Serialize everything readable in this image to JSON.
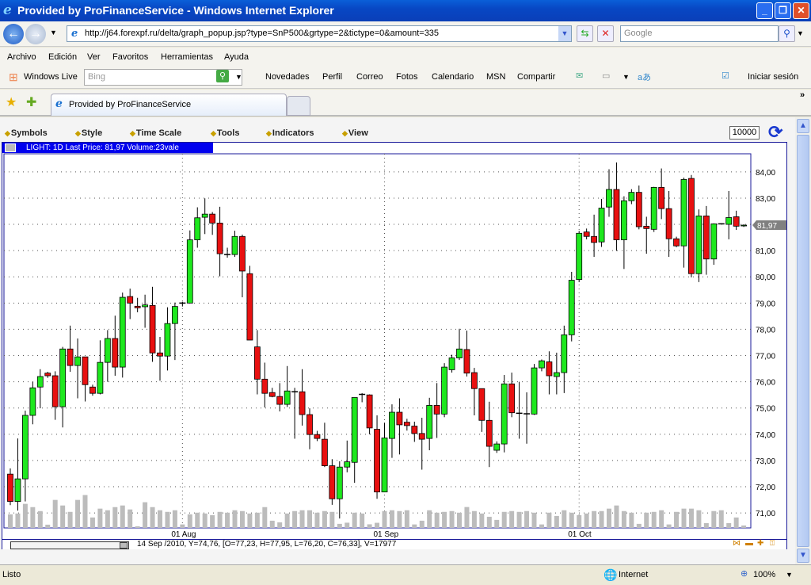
{
  "window": {
    "title": "Provided by ProFinanceService - Windows Internet Explorer"
  },
  "address": {
    "url": "http://j64.forexpf.ru/delta/graph_popup.jsp?type=SnP500&grtype=2&tictype=0&amount=335",
    "search_placeholder": "Google"
  },
  "menu": [
    "Archivo",
    "Edición",
    "Ver",
    "Favoritos",
    "Herramientas",
    "Ayuda"
  ],
  "links": {
    "brand": "Windows Live",
    "search_placeholder": "Bing",
    "items": [
      "Novedades",
      "Perfil",
      "Correo",
      "Fotos",
      "Calendario",
      "MSN",
      "Compartir"
    ],
    "signin": "Iniciar sesión"
  },
  "tab": {
    "title": "Provided by ProFinanceService"
  },
  "chart_toolbar": {
    "items": [
      "Symbols",
      "Style",
      "Time Scale",
      "Tools",
      "Indicators",
      "View"
    ],
    "amount": "10000"
  },
  "info": "LIGHT: 1D Last Price: 81,97 Volume:23vale",
  "crosshair_readout": "14 Sep /2010, Y=74,76, [O=77,23, H=77,95, L=76,20, C=76,33], V=17977",
  "status": {
    "left": "Listo",
    "zone": "Internet",
    "zoom": "100%"
  },
  "colors": {
    "up": "#1ee81e",
    "down": "#e81010",
    "volume": "#bcbcbc",
    "frame": "#1a1a9a",
    "infobar": "#0000ee"
  },
  "chart_data": {
    "type": "candlestick",
    "symbol": "LIGHT",
    "interval": "1D",
    "ylim": [
      70.43,
      84.69
    ],
    "yticks": [
      "84,00",
      "83,00",
      "82,00",
      "81,00",
      "80,00",
      "79,00",
      "78,00",
      "77,00",
      "76,00",
      "75,00",
      "74,00",
      "73,00",
      "72,00",
      "71,00"
    ],
    "ytick_values": [
      84,
      83,
      82,
      81,
      80,
      79,
      78,
      77,
      76,
      75,
      74,
      73,
      72,
      71
    ],
    "last_price": 81.97,
    "last_price_label": "81,97",
    "xticks": [
      {
        "label": "01 Aug",
        "candle": 24
      },
      {
        "label": "01 Sep",
        "candle": 51
      },
      {
        "label": "01 Oct",
        "candle": 77
      }
    ],
    "grid": true,
    "ohlc": [
      [
        72.48,
        72.7,
        71.3,
        71.44
      ],
      [
        71.44,
        73.84,
        71.09,
        72.3
      ],
      [
        72.3,
        74.9,
        71.44,
        74.72
      ],
      [
        74.72,
        76.0,
        74.38,
        75.77
      ],
      [
        75.8,
        76.48,
        74.99,
        76.2
      ],
      [
        76.33,
        76.38,
        76.15,
        76.23
      ],
      [
        76.23,
        76.4,
        74.55,
        75.05
      ],
      [
        75.05,
        77.33,
        74.26,
        77.25
      ],
      [
        77.25,
        78.14,
        76.38,
        76.62
      ],
      [
        76.62,
        77.65,
        75.37,
        76.95
      ],
      [
        76.95,
        76.95,
        75.25,
        75.89
      ],
      [
        75.8,
        75.89,
        75.47,
        75.56
      ],
      [
        75.56,
        77.58,
        75.52,
        76.74
      ],
      [
        76.74,
        77.97,
        76.0,
        77.65
      ],
      [
        77.65,
        78.52,
        76.23,
        76.56
      ],
      [
        76.56,
        79.4,
        76.16,
        79.22
      ],
      [
        79.25,
        79.55,
        78.39,
        79.0
      ],
      [
        78.88,
        79.2,
        78.65,
        78.82
      ],
      [
        78.86,
        79.32,
        78.06,
        78.93
      ],
      [
        78.91,
        79.62,
        76.76,
        77.1
      ],
      [
        77.1,
        77.71,
        76.04,
        76.98
      ],
      [
        76.98,
        78.84,
        76.43,
        78.22
      ],
      [
        78.22,
        79.02,
        76.83,
        78.87
      ],
      [
        79.0,
        79.05,
        78.87,
        79.0
      ],
      [
        79.0,
        81.77,
        79.0,
        81.41
      ],
      [
        81.41,
        82.65,
        81.11,
        82.25
      ],
      [
        82.27,
        82.99,
        81.63,
        82.39
      ],
      [
        82.39,
        82.47,
        81.6,
        82.05
      ],
      [
        82.05,
        82.67,
        80.02,
        80.88
      ],
      [
        80.85,
        81.11,
        80.73,
        80.85
      ],
      [
        80.85,
        81.76,
        80.76,
        81.54
      ],
      [
        81.54,
        81.61,
        79.22,
        80.22
      ],
      [
        80.12,
        80.42,
        77.59,
        77.59
      ],
      [
        77.33,
        77.97,
        75.52,
        76.1
      ],
      [
        76.1,
        76.73,
        75.02,
        75.56
      ],
      [
        75.59,
        75.77,
        75.41,
        75.44
      ],
      [
        75.44,
        75.95,
        74.87,
        75.14
      ],
      [
        75.14,
        76.6,
        75.04,
        75.65
      ],
      [
        75.62,
        75.77,
        73.83,
        75.62
      ],
      [
        75.62,
        76.48,
        74.33,
        74.75
      ],
      [
        74.75,
        74.99,
        73.43,
        73.99
      ],
      [
        73.99,
        74.13,
        73.74,
        73.84
      ],
      [
        73.81,
        74.44,
        72.75,
        72.8
      ],
      [
        72.8,
        73.05,
        71.31,
        71.54
      ],
      [
        71.54,
        72.97,
        70.79,
        72.75
      ],
      [
        72.75,
        73.76,
        72.55,
        72.95
      ],
      [
        72.93,
        75.4,
        72.15,
        75.4
      ],
      [
        75.52,
        75.57,
        75.22,
        75.52
      ],
      [
        75.5,
        75.52,
        74.0,
        74.24
      ],
      [
        74.19,
        74.72,
        71.54,
        71.8
      ],
      [
        71.8,
        74.44,
        71.8,
        73.86
      ],
      [
        73.84,
        75.14,
        73.1,
        74.84
      ],
      [
        74.84,
        75.37,
        73.23,
        74.36
      ],
      [
        74.46,
        74.59,
        74.14,
        74.33
      ],
      [
        74.31,
        74.48,
        73.71,
        74.03
      ],
      [
        74.03,
        74.63,
        72.65,
        73.81
      ],
      [
        73.84,
        75.39,
        73.39,
        75.1
      ],
      [
        75.1,
        75.95,
        73.86,
        74.77
      ],
      [
        74.77,
        76.71,
        74.65,
        76.56
      ],
      [
        76.46,
        77.03,
        76.35,
        76.91
      ],
      [
        76.91,
        78.02,
        76.83,
        77.25
      ],
      [
        77.23,
        77.95,
        76.2,
        76.33
      ],
      [
        76.35,
        76.53,
        74.72,
        75.74
      ],
      [
        75.74,
        75.74,
        74.09,
        74.53
      ],
      [
        74.53,
        75.24,
        72.75,
        73.54
      ],
      [
        73.39,
        73.73,
        73.29,
        73.63
      ],
      [
        73.63,
        76.26,
        73.31,
        75.92
      ],
      [
        75.92,
        76.35,
        74.65,
        74.82
      ],
      [
        74.8,
        76.0,
        73.83,
        74.8
      ],
      [
        74.78,
        75.6,
        73.64,
        74.78
      ],
      [
        74.77,
        76.68,
        74.74,
        76.53
      ],
      [
        76.53,
        76.85,
        76.4,
        76.8
      ],
      [
        76.76,
        77.16,
        75.52,
        76.23
      ],
      [
        76.2,
        77.11,
        75.52,
        76.35
      ],
      [
        76.35,
        78.14,
        75.57,
        77.79
      ],
      [
        77.79,
        80.19,
        77.54,
        79.87
      ],
      [
        79.9,
        81.75,
        79.8,
        81.66
      ],
      [
        81.71,
        81.84,
        81.43,
        81.54
      ],
      [
        81.54,
        82.37,
        80.76,
        81.31
      ],
      [
        81.33,
        82.97,
        81.14,
        82.62
      ],
      [
        82.66,
        84.1,
        82.29,
        83.33
      ],
      [
        83.33,
        84.36,
        80.99,
        81.41
      ],
      [
        81.41,
        83.07,
        80.3,
        82.9
      ],
      [
        82.9,
        83.34,
        82.77,
        83.22
      ],
      [
        83.22,
        83.48,
        81.81,
        81.91
      ],
      [
        81.93,
        82.29,
        80.88,
        81.84
      ],
      [
        81.81,
        83.43,
        81.71,
        83.41
      ],
      [
        83.41,
        84.13,
        82.2,
        82.6
      ],
      [
        82.6,
        83.27,
        80.76,
        81.45
      ],
      [
        81.45,
        81.53,
        81.13,
        81.18
      ],
      [
        81.18,
        83.78,
        80.35,
        83.71
      ],
      [
        83.75,
        83.88,
        79.98,
        80.12
      ],
      [
        80.12,
        82.57,
        79.8,
        82.32
      ],
      [
        82.32,
        82.7,
        80.08,
        80.68
      ],
      [
        80.68,
        82.04,
        80.46,
        82.02
      ],
      [
        82.02,
        82.04,
        82.0,
        82.02
      ],
      [
        82.0,
        83.27,
        81.43,
        82.26
      ],
      [
        82.29,
        82.52,
        81.79,
        81.93
      ],
      [
        81.94,
        82.0,
        81.9,
        81.97
      ]
    ],
    "volume": [
      11700,
      12400,
      20700,
      17900,
      14500,
      2800,
      24100,
      19300,
      13800,
      24100,
      28300,
      9000,
      16600,
      15200,
      17900,
      19300,
      15900,
      1400,
      22100,
      17900,
      15200,
      13800,
      15200,
      3000,
      11700,
      13100,
      12400,
      11000,
      13800,
      13100,
      15200,
      14500,
      12400,
      13100,
      17900,
      6200,
      4800,
      12400,
      14500,
      15200,
      15200,
      13100,
      14500,
      13800,
      3500,
      4500,
      13100,
      12400,
      3100,
      4400,
      14500,
      15200,
      14500,
      15200,
      3000,
      6200,
      15200,
      13100,
      13800,
      14500,
      13100,
      17977,
      14500,
      12400,
      9600,
      6900,
      13800,
      14500,
      13800,
      14500,
      13100,
      3000,
      13100,
      10300,
      15200,
      13100,
      11000,
      12400,
      14500,
      14500,
      16600,
      19300,
      14500,
      13100,
      3500,
      13100,
      13800,
      15200,
      3000,
      13800,
      16600,
      16600,
      15200,
      4100,
      14500,
      15200,
      4100,
      9000,
      2100
    ]
  }
}
